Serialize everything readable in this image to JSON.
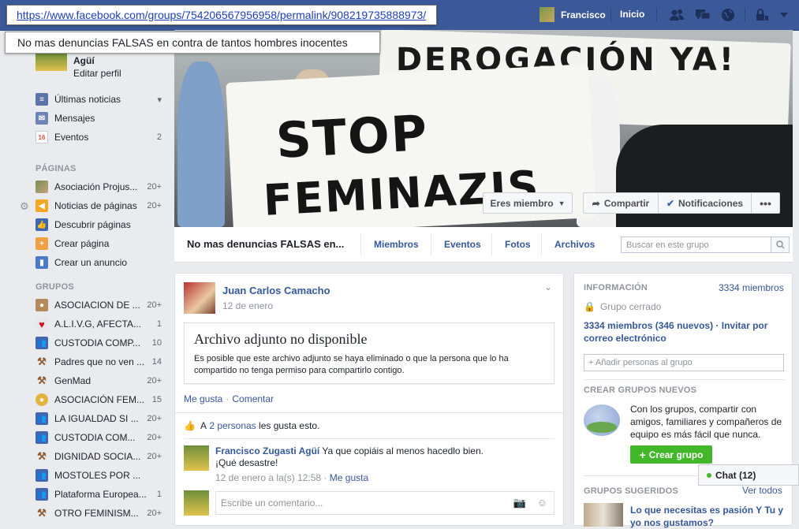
{
  "url_tooltip": "https://www.facebook.com/groups/754206567956958/permalink/908219735888973/",
  "title_tooltip": "No mas denuncias FALSAS en contra de tantos hombres inocentes",
  "topbar": {
    "user_name": "Francisco",
    "home_label": "Inicio"
  },
  "profile": {
    "name": "Agüí",
    "edit_label": "Editar perfil"
  },
  "sidebar": {
    "favorites": [
      {
        "label": "Últimas noticias",
        "icon": "news-feed-icon",
        "count": ""
      },
      {
        "label": "Mensajes",
        "icon": "messages-icon",
        "count": ""
      },
      {
        "label": "Eventos",
        "icon": "calendar-icon",
        "count": "2"
      }
    ],
    "pages_heading": "PÁGINAS",
    "pages": [
      {
        "label": "Asociación Projus...",
        "count": "20+"
      },
      {
        "label": "Noticias de páginas",
        "count": "20+"
      },
      {
        "label": "Descubrir páginas",
        "count": ""
      },
      {
        "label": "Crear página",
        "count": ""
      },
      {
        "label": "Crear un anuncio",
        "count": ""
      }
    ],
    "groups_heading": "GRUPOS",
    "groups": [
      {
        "label": "ASOCIACION DE ...",
        "count": "20+"
      },
      {
        "label": "A.L.I.V.G, AFECTA...",
        "count": "1"
      },
      {
        "label": "CUSTODIA COMP...",
        "count": "10"
      },
      {
        "label": "Padres que no ven ...",
        "count": "14"
      },
      {
        "label": "GenMad",
        "count": "20+"
      },
      {
        "label": "ASOCIACIÓN FEM...",
        "count": "15"
      },
      {
        "label": "LA IGUALDAD SI ...",
        "count": "20+"
      },
      {
        "label": "CUSTODIA COM...",
        "count": "20+"
      },
      {
        "label": "DIGNIDAD SOCIA...",
        "count": "20+"
      },
      {
        "label": "MOSTOLES POR ...",
        "count": ""
      },
      {
        "label": "Plataforma Europea...",
        "count": "1"
      },
      {
        "label": "OTRO FEMINISM...",
        "count": "20+"
      }
    ]
  },
  "cover": {
    "banner_top": "DEROGACIÓN YA!",
    "banner_main_line1": "STOP",
    "banner_main_line2": "FEMINAZIS",
    "member_button": "Eres miembro",
    "share_button": "Compartir",
    "notifications_button": "Notificaciones",
    "more_button": "•••"
  },
  "group_nav": {
    "name": "No mas denuncias FALSAS en...",
    "tabs": [
      "Miembros",
      "Eventos",
      "Fotos",
      "Archivos"
    ],
    "search_placeholder": "Buscar en este grupo"
  },
  "post": {
    "author": "Juan Carlos Camacho",
    "date": "12 de enero",
    "attachment_title": "Archivo adjunto no disponible",
    "attachment_body": "Es posible que este archivo adjunto se haya eliminado o que la persona que lo ha compartido no tenga permiso para compartirlo contigo.",
    "like_action": "Me gusta",
    "comment_action": "Comentar",
    "likes_prefix": "A",
    "likes_link": "2 personas",
    "likes_suffix": "les gusta esto.",
    "comment": {
      "name": "Francisco Zugasti Agüí",
      "text_line1": "Ya que copiáis al menos hacedlo bien.",
      "text_line2": "¡Qué desastre!",
      "time": "12 de enero a la(s) 12:58",
      "like": "Me gusta"
    },
    "write_placeholder": "Escribe un comentario..."
  },
  "right": {
    "info_heading": "INFORMACIÓN",
    "members_count": "3334 miembros",
    "closed_label": "Grupo cerrado",
    "invite_text": "3334 miembros (346 nuevos) · Invitar por correo electrónico",
    "add_people_placeholder": "+ Añadir personas al grupo",
    "create_heading": "CREAR GRUPOS NUEVOS",
    "create_text": "Con los grupos, compartir con amigos, familiares y compañeros de equipo es más fácil que nunca.",
    "create_button": "Crear grupo",
    "suggested_heading": "GRUPOS SUGERIDOS",
    "see_all": "Ver todos",
    "suggested_text": "Lo que necesitas es pasión Y Tu y yo nos gustamos?"
  },
  "chat": {
    "label": "Chat (12)"
  },
  "colors": {
    "facebook_blue": "#3b5998",
    "link_blue": "#365899",
    "create_green": "#42b72a"
  }
}
